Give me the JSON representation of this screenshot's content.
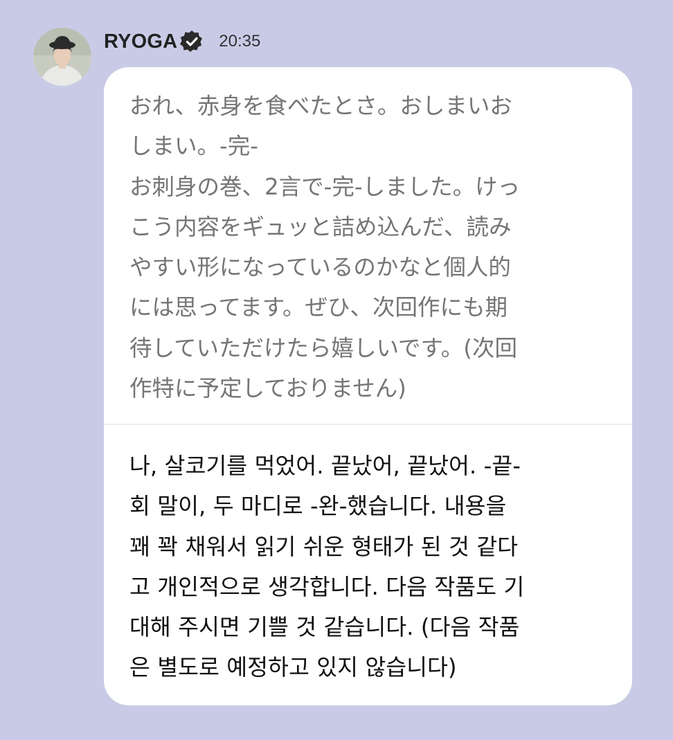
{
  "post": {
    "author": "RYOGA",
    "verified_icon": "verified-badge-icon",
    "time": "20:35",
    "avatar_icon": "profile-photo"
  },
  "messages": {
    "original": "おれ、赤身を食べたとさ。おしまいお\nしまい。-完-\nお刺身の巻、2言で-完-しました。けっ\nこう内容をギュッと詰め込んだ、読み\nやすい形になっているのかなと個人的\nには思ってます。ぜひ、次回作にも期\n待していただけたら嬉しいです。(次回\n作特に予定しておりません)",
    "translation": "나, 살코기를 먹었어. 끝났어, 끝났어. -끝-\n회 말이, 두 마디로 -완-했습니다. 내용을\n꽤 꽉 채워서 읽기 쉬운 형태가 된 것 같다\n고 개인적으로 생각합니다. 다음 작품도 기\n대해 주시면 기쁠 것 같습니다. (다음 작품\n은 별도로 예정하고 있지 않습니다)"
  },
  "colors": {
    "background": "#c9cbe6",
    "bubble": "#ffffff",
    "original_text": "#757575",
    "translation_text": "#111111"
  }
}
